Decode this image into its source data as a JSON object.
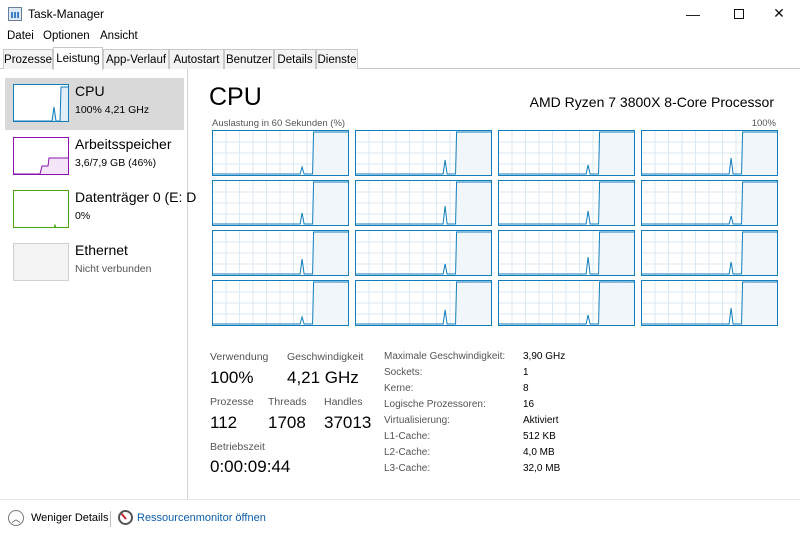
{
  "window": {
    "title": "Task-Manager",
    "minimize": "—",
    "close": "✕"
  },
  "menu": [
    "Datei",
    "Optionen",
    "Ansicht"
  ],
  "tabs": [
    {
      "label": "Prozesse",
      "active": false
    },
    {
      "label": "Leistung",
      "active": true
    },
    {
      "label": "App-Verlauf",
      "active": false
    },
    {
      "label": "Autostart",
      "active": false
    },
    {
      "label": "Benutzer",
      "active": false
    },
    {
      "label": "Details",
      "active": false
    },
    {
      "label": "Dienste",
      "active": false
    }
  ],
  "sidebar": [
    {
      "title": "CPU",
      "subtitle": "100% 4,21 GHz",
      "color": "#117dbb",
      "selected": true,
      "icon": "cpu-graph"
    },
    {
      "title": "Arbeitsspeicher",
      "subtitle": "3,6/7,9 GB (46%)",
      "color": "#8b12ae",
      "selected": false,
      "icon": "memory-graph"
    },
    {
      "title": "Datenträger 0 (E: D",
      "subtitle": "0%",
      "color": "#4da60c",
      "selected": false,
      "icon": "disk-graph"
    },
    {
      "title": "Ethernet",
      "subtitle": "Nicht verbunden",
      "color": "#a7a7a7",
      "selected": false,
      "icon": "network-graph"
    }
  ],
  "main": {
    "title": "CPU",
    "processor": "AMD Ryzen 7 3800X 8-Core Processor",
    "axis_label": "Auslastung in 60 Sekunden (%)",
    "axis_max": "100%",
    "core_count_shown": 16,
    "stats": {
      "usage_label": "Verwendung",
      "usage_value": "100%",
      "speed_label": "Geschwindigkeit",
      "speed_value": "4,21 GHz",
      "processes_label": "Prozesse",
      "processes_value": "112",
      "threads_label": "Threads",
      "threads_value": "1708",
      "handles_label": "Handles",
      "handles_value": "37013",
      "uptime_label": "Betriebszeit",
      "uptime_value": "0:00:09:44"
    },
    "details": [
      {
        "label": "Maximale Geschwindigkeit:",
        "value": "3,90 GHz"
      },
      {
        "label": "Sockets:",
        "value": "1"
      },
      {
        "label": "Kerne:",
        "value": "8"
      },
      {
        "label": "Logische Prozessoren:",
        "value": "16"
      },
      {
        "label": "Virtualisierung:",
        "value": "Aktiviert"
      },
      {
        "label": "L1-Cache:",
        "value": "512 KB"
      },
      {
        "label": "L2-Cache:",
        "value": "4,0 MB"
      },
      {
        "label": "L3-Cache:",
        "value": "32,0 MB"
      }
    ]
  },
  "footer": {
    "fewer_details": "Weniger Details",
    "resource_monitor": "Ressourcenmonitor öffnen"
  },
  "colors": {
    "cpu": "#117dbb",
    "grid": "#d9eaf4",
    "fill": "#f1f6fa"
  }
}
